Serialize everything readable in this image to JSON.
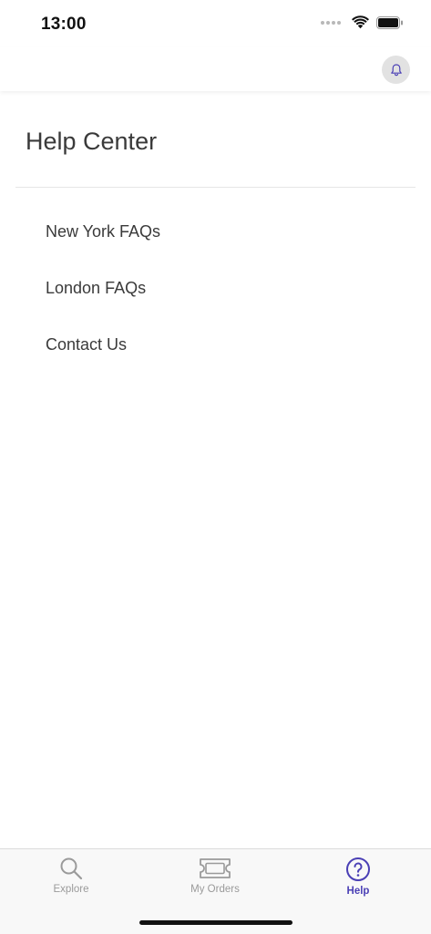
{
  "status_bar": {
    "time": "13:00"
  },
  "header": {
    "bell_icon": "bell-icon"
  },
  "main": {
    "title": "Help Center",
    "items": [
      {
        "label": "New York FAQs"
      },
      {
        "label": "London FAQs"
      },
      {
        "label": "Contact Us"
      }
    ]
  },
  "tab_bar": {
    "tabs": [
      {
        "label": "Explore",
        "icon": "search-icon",
        "active": false
      },
      {
        "label": "My Orders",
        "icon": "ticket-icon",
        "active": false
      },
      {
        "label": "Help",
        "icon": "help-icon",
        "active": true
      }
    ]
  },
  "colors": {
    "accent": "#4a3fb5",
    "inactive": "#9a9a9a",
    "bell_bg": "#e2e2e2"
  }
}
